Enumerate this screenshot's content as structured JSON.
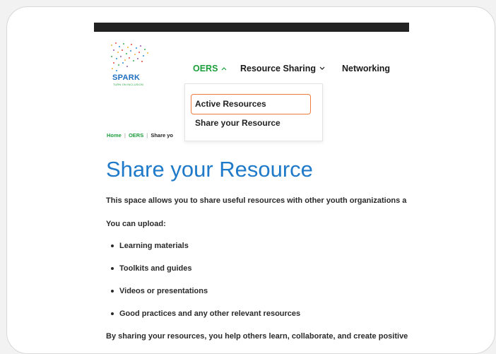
{
  "logo": {
    "name": "SPARK",
    "tagline": "TURN ON INCLUSION"
  },
  "nav": [
    {
      "label": "OERS",
      "active": true
    },
    {
      "label": "Resource Sharing",
      "active": false
    },
    {
      "label": "Networking",
      "active": false
    }
  ],
  "dropdown": {
    "items": [
      {
        "label": "Active Resources",
        "highlighted": true
      },
      {
        "label": "Share your Resource",
        "highlighted": false
      }
    ]
  },
  "breadcrumb": {
    "home": "Home",
    "oers": "OERS",
    "current": "Share yo"
  },
  "page": {
    "title": "Share your Resource",
    "intro": "This space allows you to share useful resources with other youth organizations a",
    "upload_label": "You can upload:",
    "bullets": [
      "Learning materials",
      "Toolkits and guides",
      "Videos or presentations",
      "Good practices and any other relevant resources"
    ],
    "closing": "By sharing your resources, you help others learn, collaborate, and create positive"
  },
  "colors": {
    "accent_green": "#1d9e3c",
    "title_blue": "#1f7ac9",
    "highlight_orange": "#f07c3c",
    "topbar": "#222222"
  }
}
